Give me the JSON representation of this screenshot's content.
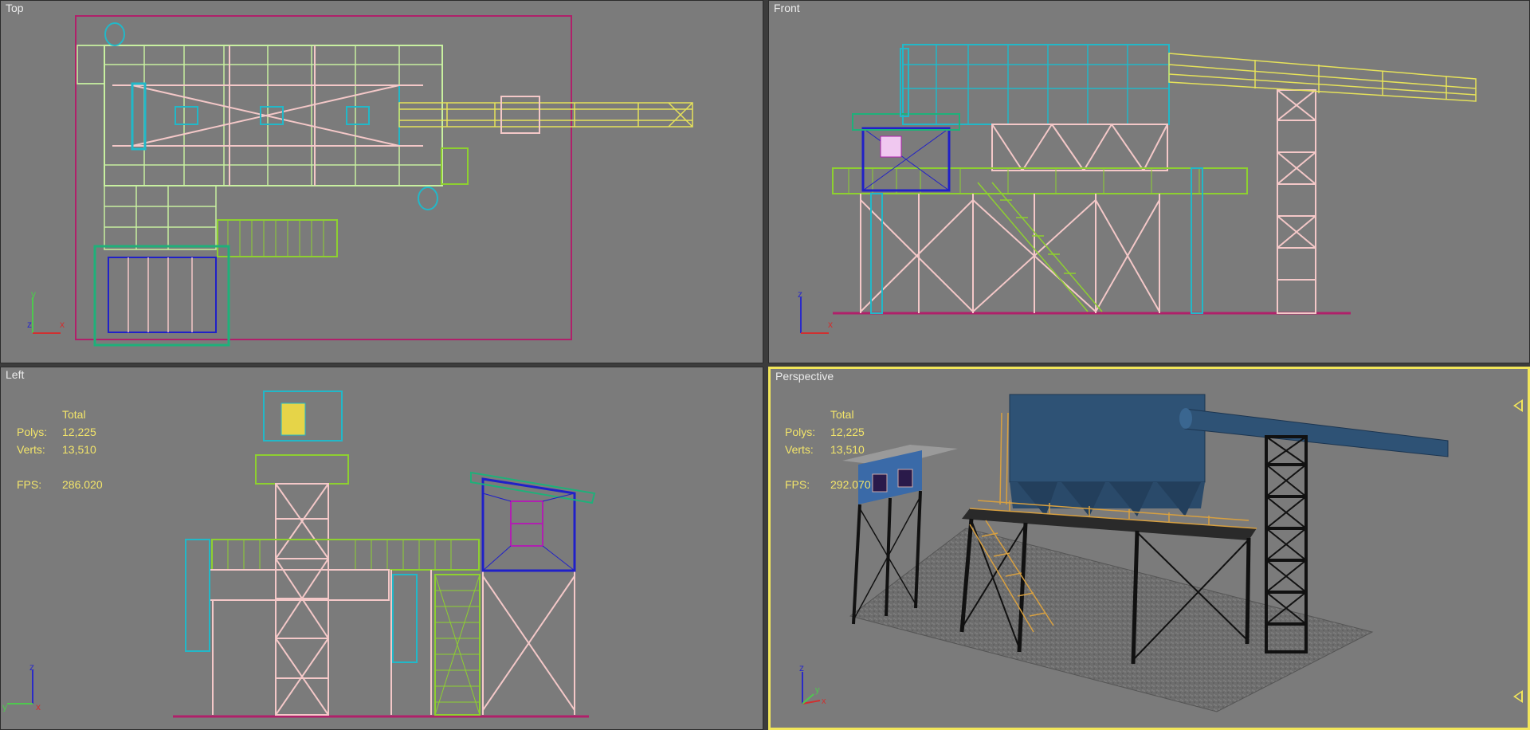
{
  "viewports": {
    "top": {
      "label": "Top"
    },
    "front": {
      "label": "Front"
    },
    "left": {
      "label": "Left",
      "stats": {
        "header": "Total",
        "polys_label": "Polys:",
        "polys": "12,225",
        "verts_label": "Verts:",
        "verts": "13,510",
        "fps_label": "FPS:",
        "fps": "286.020"
      }
    },
    "perspective": {
      "label": "Perspective",
      "active": true,
      "stats": {
        "header": "Total",
        "polys_label": "Polys:",
        "polys": "12,225",
        "verts_label": "Verts:",
        "verts": "13,510",
        "fps_label": "FPS:",
        "fps": "292.070"
      }
    }
  },
  "axes": {
    "top": [
      "y",
      "z",
      "x"
    ],
    "front": [
      "z",
      "y",
      "x"
    ],
    "left": [
      "z",
      "y",
      "x"
    ],
    "perspective": [
      "z",
      "y",
      "x"
    ]
  },
  "colors": {
    "viewport_bg": "#7b7b7b",
    "active_border": "#f2e65a",
    "stats_text": "#f3e56a",
    "wire_yellow": "#e6e25a",
    "wire_cyan": "#22b8c8",
    "wire_pink": "#f4c8c8",
    "wire_green": "#8ed030",
    "wire_lightgreen": "#c8f0a0",
    "wire_blue": "#2020c8",
    "wire_magenta": "#b0206a"
  }
}
